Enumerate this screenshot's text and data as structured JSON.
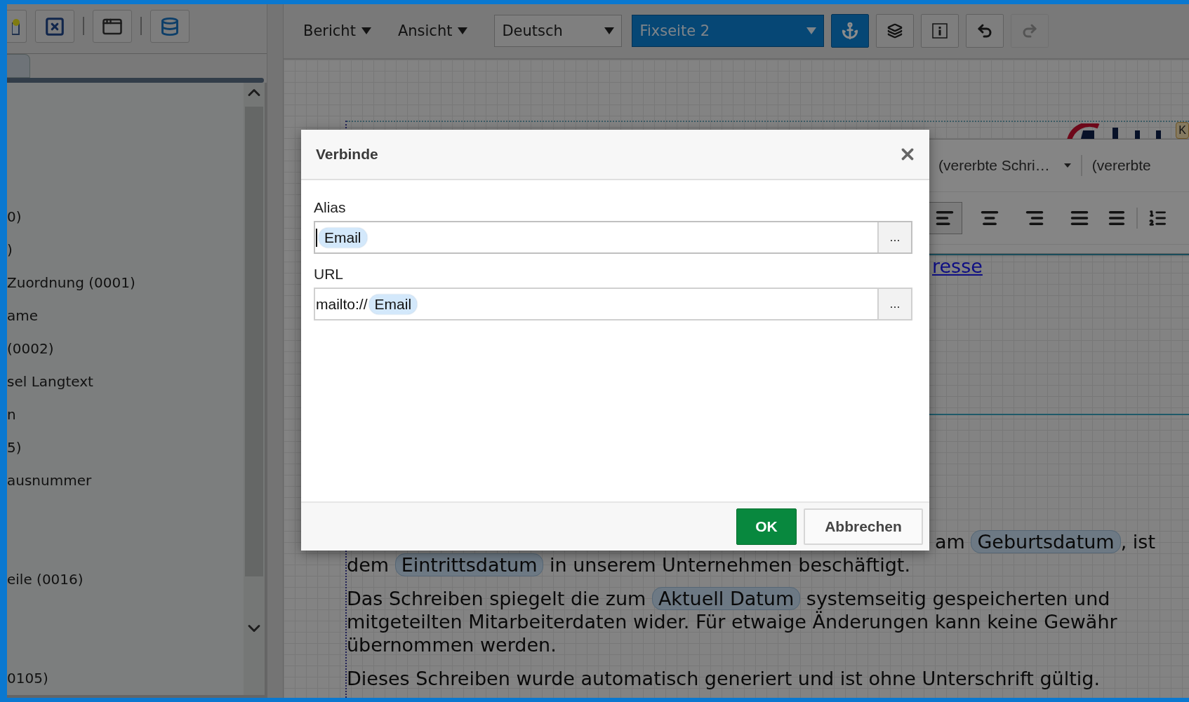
{
  "sidebar": {
    "items": [
      {
        "label": "0)"
      },
      {
        "label": ")"
      },
      {
        "label": "Zuordnung (0001)"
      },
      {
        "label": "ame"
      },
      {
        "label": "(0002)"
      },
      {
        "label": "sel Langtext"
      },
      {
        "label": "n"
      },
      {
        "label": "5)"
      },
      {
        "label": "ausnummer"
      },
      {
        "label": "eile (0016)"
      },
      {
        "label": "0105)"
      }
    ]
  },
  "toolbar": {
    "menus": [
      {
        "label": "Bericht"
      },
      {
        "label": "Ansicht"
      }
    ],
    "dropdowns": [
      {
        "value": "Deutsch",
        "kind": "plain"
      },
      {
        "value": "Fixseite 2",
        "kind": "accent"
      }
    ],
    "tools": [
      {
        "kind": "anchor",
        "active": true,
        "disabled": false
      },
      {
        "kind": "layers",
        "active": false,
        "disabled": false
      },
      {
        "kind": "info",
        "active": false,
        "disabled": false
      },
      {
        "kind": "undo",
        "active": false,
        "disabled": false
      },
      {
        "kind": "redo",
        "active": false,
        "disabled": true
      }
    ]
  },
  "format_bar": {
    "dropdowns": [
      "(vererbte Schri…",
      "(vererbte"
    ],
    "align": [
      {
        "kind": "left",
        "selected": true
      },
      {
        "kind": "center",
        "selected": false
      },
      {
        "kind": "right",
        "selected": false
      },
      {
        "kind": "justify",
        "selected": false
      }
    ]
  },
  "document": {
    "badge": "K",
    "link": "resse",
    "paragraphs": [
      {
        "lines": [
          [
            {
              "kind": "text",
              "text": "am "
            },
            {
              "kind": "field",
              "text": "Geburtsdatum"
            },
            {
              "kind": "text",
              "text": ", ist"
            }
          ],
          [
            {
              "kind": "text",
              "text": "dem "
            },
            {
              "kind": "field",
              "text": "Eintrittsdatum"
            },
            {
              "kind": "text",
              "text": " in unserem Unternehmen beschäftigt."
            }
          ]
        ]
      },
      {
        "lines": [
          [
            {
              "kind": "text",
              "text": "Das Schreiben spiegelt die zum "
            },
            {
              "kind": "field",
              "text": "Aktuell Datum"
            },
            {
              "kind": "text",
              "text": " systemseitig gespeicherten und"
            }
          ],
          [
            {
              "kind": "text",
              "text": "mitgeteilten Mitarbeiterdaten wider. Für etwaige Änderungen kann keine Gewähr"
            }
          ],
          [
            {
              "kind": "text",
              "text": "übernommen werden."
            }
          ]
        ]
      },
      {
        "lines": [
          [
            {
              "kind": "text",
              "text": "Dieses Schreiben wurde automatisch generiert und ist ohne Unterschrift gültig."
            }
          ]
        ]
      }
    ]
  },
  "dialog": {
    "title": "Verbinde",
    "fields": [
      {
        "label": "Alias",
        "chip": "Email",
        "button": "...",
        "focused": true
      },
      {
        "label": "URL",
        "prefix": "mailto://",
        "chip": "Email",
        "button": "...",
        "focused": false
      }
    ],
    "buttons": [
      {
        "label": "OK",
        "kind": "primary"
      },
      {
        "label": "Abbrechen",
        "kind": "secondary"
      }
    ]
  }
}
